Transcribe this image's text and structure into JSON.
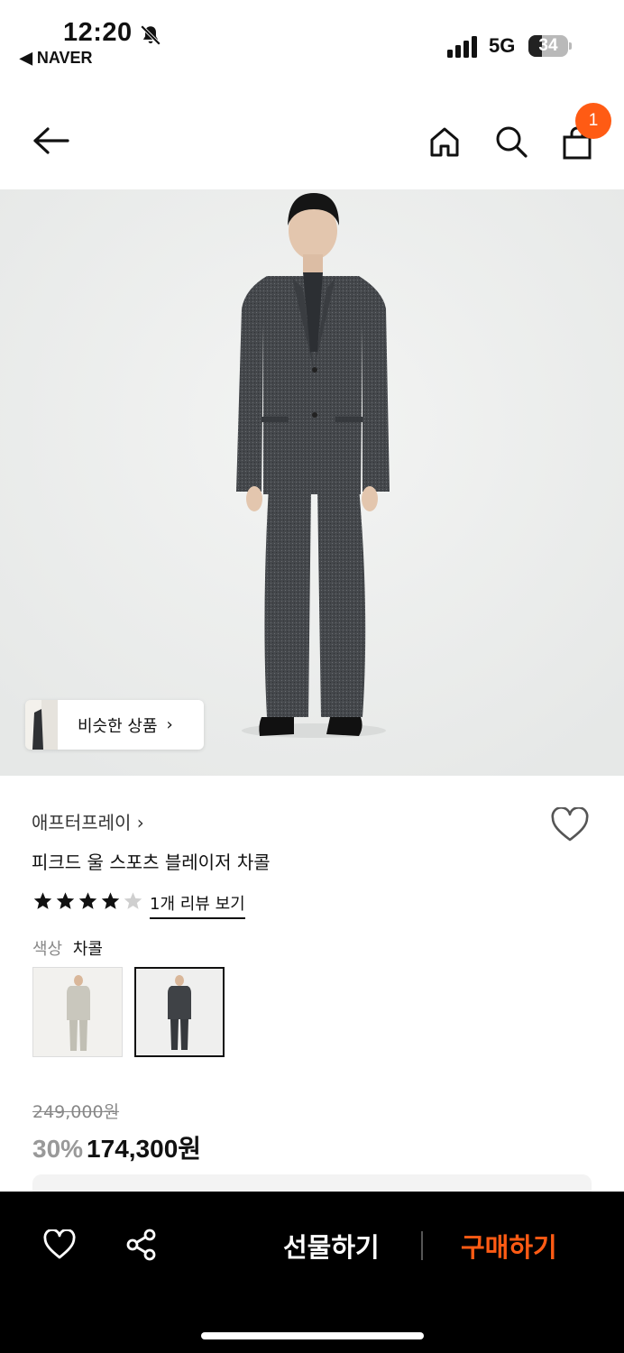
{
  "status_bar": {
    "time": "12:20",
    "back_app": "◀ NAVER",
    "network": "5G",
    "battery_percent": 34
  },
  "header": {
    "back_icon": "arrow-left-icon",
    "home_icon": "home-icon",
    "search_icon": "search-icon",
    "cart_icon": "shopping-bag-icon",
    "cart_count": "1"
  },
  "hero": {
    "similar_button_label": "비슷한 상품",
    "similar_chevron": "›"
  },
  "product": {
    "brand": "애프터프레이 ›",
    "title": "피크드 울 스포츠 블레이저 차콜",
    "rating": 4,
    "rating_max": 5,
    "review_link": "1개 리뷰 보기",
    "color_label": "색상",
    "color_value": "차콜",
    "swatches": [
      "beige",
      "charcoal"
    ],
    "selected_swatch": "charcoal",
    "original_price": "249,000원",
    "discount": "30%",
    "sale_price": "174,300원"
  },
  "bottom_bar": {
    "wishlist_icon": "heart-icon",
    "share_icon": "share-icon",
    "gift_label": "선물하기",
    "buy_label": "구매하기"
  },
  "colors": {
    "accent": "#ff5b14",
    "bottom_bar_bg": "#000000",
    "hero_bg": "#eef0ef"
  }
}
